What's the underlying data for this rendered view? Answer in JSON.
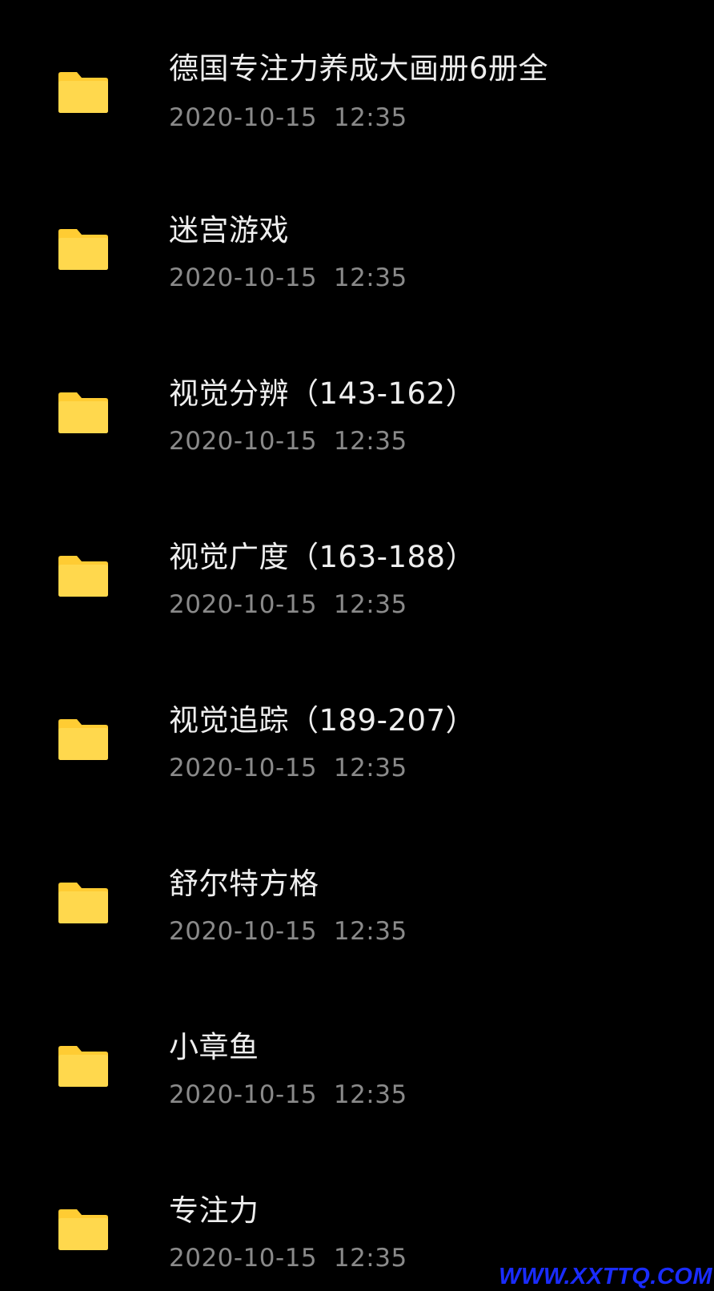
{
  "folders": [
    {
      "name": "德国专注力养成大画册6册全",
      "date": "2020-10-15  12:35"
    },
    {
      "name": "迷宫游戏",
      "date": "2020-10-15  12:35"
    },
    {
      "name": "视觉分辨（143-162）",
      "date": "2020-10-15  12:35"
    },
    {
      "name": "视觉广度（163-188）",
      "date": "2020-10-15  12:35"
    },
    {
      "name": "视觉追踪（189-207）",
      "date": "2020-10-15  12:35"
    },
    {
      "name": "舒尔特方格",
      "date": "2020-10-15  12:35"
    },
    {
      "name": "小章鱼",
      "date": "2020-10-15  12:35"
    },
    {
      "name": "专注力",
      "date": "2020-10-15  12:35"
    }
  ],
  "icons": {
    "folder": "folder-icon"
  },
  "colors": {
    "background": "#000000",
    "folder_fill": "#ffd84d",
    "folder_tab": "#ffcc33",
    "name_text": "#eeeeee",
    "date_text": "#8a8a8a",
    "watermark": "#1a2cff"
  },
  "watermark": "WWW.XXTTQ.COM"
}
